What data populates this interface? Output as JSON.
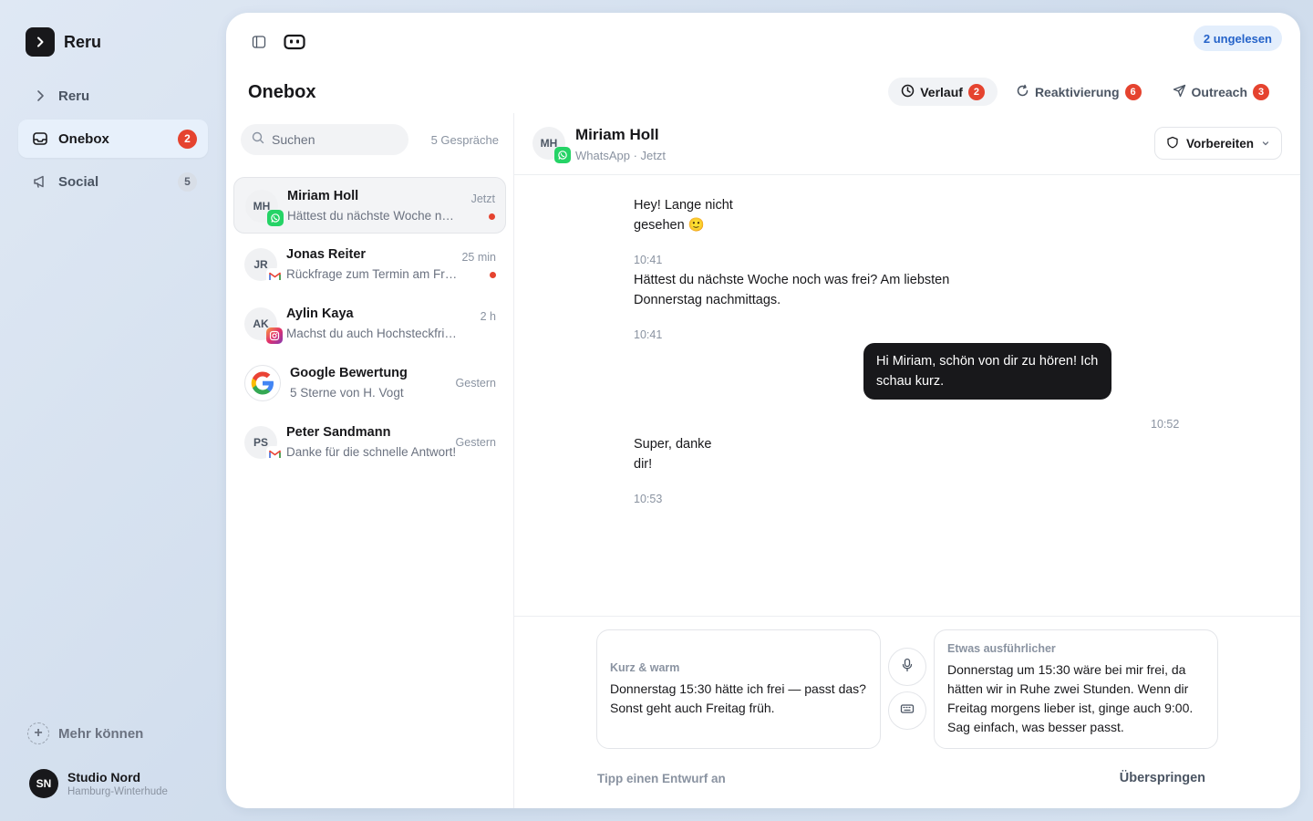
{
  "app": {
    "name": "Reru",
    "logo_icon": "chevron-right-icon"
  },
  "sidebar": {
    "items": [
      {
        "label": "Reru",
        "icon": "chevron-right-icon",
        "badge": ""
      },
      {
        "label": "Onebox",
        "icon": "inbox-icon",
        "badge": "2",
        "active": true
      },
      {
        "label": "Social",
        "icon": "megaphone-icon",
        "badge": "5"
      }
    ],
    "more_label": "Mehr können",
    "account": {
      "initials": "SN",
      "name": "Studio Nord",
      "location": "Hamburg-Winterhude"
    }
  },
  "topbar": {
    "unread_label": "2 ungelesen"
  },
  "page": {
    "title": "Onebox",
    "tabs": [
      {
        "label": "Verlauf",
        "icon": "clock-icon",
        "badge": "2",
        "active": true
      },
      {
        "label": "Reaktivierung",
        "icon": "refresh-icon",
        "badge": "6"
      },
      {
        "label": "Outreach",
        "icon": "send-icon",
        "badge": "3"
      }
    ]
  },
  "conversations": {
    "search_placeholder": "Suchen",
    "count_label": "5 Gespräche",
    "items": [
      {
        "initials": "MH",
        "channel": "whatsapp",
        "name": "Miriam Holl",
        "preview": "Hättest du nächste Woche noch was frei? Am liebsten Donnerstag nachmittags.",
        "time": "Jetzt",
        "unread": true,
        "active": true
      },
      {
        "initials": "JR",
        "channel": "gmail",
        "name": "Jonas Reiter",
        "preview": "Rückfrage zum Termin am Freitag",
        "time": "25 min",
        "unread": true
      },
      {
        "initials": "AK",
        "channel": "instagram",
        "name": "Aylin Kaya",
        "preview": "Machst du auch Hochsteckfrisuren?",
        "time": "2 h",
        "unread": false
      },
      {
        "initials": "G",
        "channel": "google",
        "name": "Google Bewertung",
        "preview": "5 Sterne von H. Vogt",
        "time": "Gestern",
        "unread": false
      },
      {
        "initials": "PS",
        "channel": "gmail",
        "name": "Peter Sandmann",
        "preview": "Danke für die schnelle Antwort!",
        "time": "Gestern",
        "unread": false
      }
    ]
  },
  "chat": {
    "initials": "MH",
    "name": "Miriam Holl",
    "meta": "WhatsApp · Jetzt",
    "prepare_label": "Vorbereiten",
    "messages": [
      {
        "direction": "in",
        "line1": "Hey! Lange nicht",
        "line2": "gesehen 🙂",
        "time": "10:41"
      },
      {
        "direction": "in",
        "line1": "Hättest du nächste Woche noch was frei? Am liebsten",
        "line2": "Donnerstag nachmittags.",
        "time": "10:41"
      },
      {
        "direction": "out",
        "text": "Hi Miriam, schön von dir zu hören! Ich schau kurz.",
        "time": "10:52"
      },
      {
        "direction": "in",
        "line1": "Super, danke",
        "line2": "dir!",
        "time": "10:53"
      }
    ]
  },
  "composer": {
    "drafts": [
      {
        "label": "Kurz & warm",
        "text": "Donnerstag 15:30 hätte ich frei — passt das? Sonst geht auch Freitag früh."
      },
      {
        "label": "Etwas ausführlicher",
        "text": "Donnerstag um 15:30 wäre bei mir frei, da hätten wir in Ruhe zwei Stunden. Wenn dir Freitag morgens lieber ist, ginge auch 9:00. Sag einfach, was besser passt."
      }
    ],
    "hint": "Tipp einen Entwurf an",
    "skip_label": "Überspringen"
  }
}
